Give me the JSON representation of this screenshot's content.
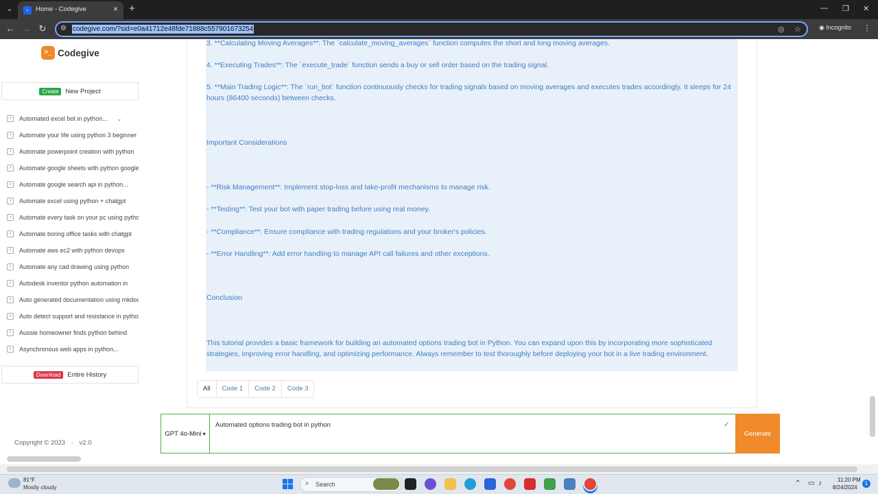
{
  "browser": {
    "tab_title": "Home - Codegive",
    "url": "codegive.com/?sid=e0a41712e48fde71888c557901673254",
    "incognito_label": "Incognito"
  },
  "sidebar": {
    "brand": "Codegive",
    "create_badge": "Create",
    "new_project_label": "New Project",
    "history": [
      "Automated excel bot in python...",
      "Automate your life using python 3 beginner",
      "Automate powerpoint creation with python",
      "Automate google sheets with python google",
      "Automate google search api in python...",
      "Automate excel using python + chatgpt",
      "Automate every task on your pc using python",
      "Automate boring office tasks with chatgpt",
      "Automate aws ec2 with python devops",
      "Automate any cad drawing using python",
      "Autodesk inventor python automation in",
      "Auto generated documentation using mkdocs",
      "Auto detect support and resistance in python",
      "Aussie homeowner finds python behind",
      "Asynchronous web apps in python..."
    ],
    "download_badge": "Download",
    "download_label": "Entire History",
    "copyright": "Copyright © 2023",
    "version": "v2.0"
  },
  "answer": {
    "line1": "3. **Calculating Moving Averages**: The `calculate_moving_averages` function computes the short and long moving averages.",
    "line2": "4. **Executing Trades**: The `execute_trade` function sends a buy or sell order based on the trading signal.",
    "line3": "5. **Main Trading Logic**: The `run_bot` function continuously checks for trading signals based on moving averages and executes trades accordingly. It sleeps for 24 hours (86400 seconds) between checks.",
    "heading1": "Important Considerations",
    "bullet1": "- **Risk Management**: Implement stop-loss and take-profit mechanisms to manage risk.",
    "bullet2": "- **Testing**: Test your bot with paper trading before using real money.",
    "bullet3": "- **Compliance**: Ensure compliance with trading regulations and your broker's policies.",
    "bullet4": "- **Error Handling**: Add error handling to manage API call failures and other exceptions.",
    "heading2": "Conclusion",
    "conclusion": "This tutorial provides a basic framework for building an automated options trading bot in Python. You can expand upon this by incorporating more sophisticated strategies, improving error handling, and optimizing performance. Always remember to test thoroughly before deploying your bot in a live trading environment."
  },
  "code_tabs": [
    "All",
    "Code 1",
    "Code 2",
    "Code 3"
  ],
  "prompt": {
    "model": "GPT 4o-Mini",
    "text": "Automated options trading bot in python",
    "generate_label": "Generate"
  },
  "taskbar": {
    "temp": "81°F",
    "weather": "Mostly cloudy",
    "search_label": "Search",
    "time": "11:20 PM",
    "date": "8/24/2024"
  },
  "colors": {
    "accent": "#f08a2a",
    "answer_text": "#3f7fc4",
    "answer_bg": "#e8f0f9",
    "input_border": "#4caf50"
  }
}
